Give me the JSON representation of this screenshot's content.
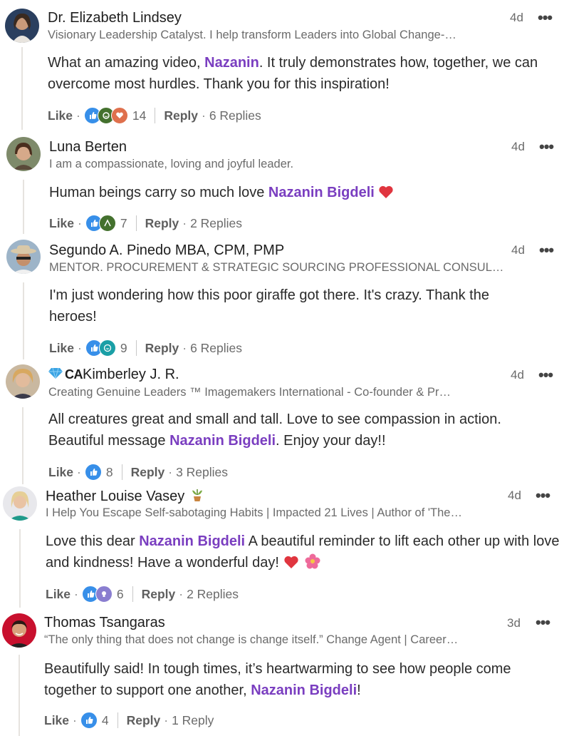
{
  "comments": [
    {
      "name": "Dr. Elizabeth Lindsey",
      "headline": "Visionary Leadership Catalyst. I help transform Leaders into Global Change-…",
      "time": "4d",
      "text_parts": [
        "What an amazing video, ",
        "Nazanin",
        ". It truly demonstrates how, together, we can overcome most hurdles. Thank you for this inspiration!"
      ],
      "like": "Like",
      "reactions": [
        "like",
        "celebrate",
        "love"
      ],
      "count": "14",
      "reply": "Reply",
      "replies": "6 Replies"
    },
    {
      "name": "Luna Berten",
      "headline": "I am a compassionate, loving and joyful leader.",
      "time": "4d",
      "text_parts": [
        "Human beings carry so much love ",
        "Nazanin Bigdeli",
        " "
      ],
      "like": "Like",
      "reactions": [
        "like",
        "support"
      ],
      "count": "7",
      "reply": "Reply",
      "replies": "2 Replies"
    },
    {
      "name": "Segundo A. Pinedo MBA, CPM, PMP",
      "headline": "MENTOR. PROCUREMENT & STRATEGIC SOURCING PROFESSIONAL CONSUL…",
      "time": "4d",
      "text_parts": [
        "I'm just wondering how this poor giraffe got there. It's crazy. Thank the heroes!"
      ],
      "like": "Like",
      "reactions": [
        "like",
        "funny"
      ],
      "count": "9",
      "reply": "Reply",
      "replies": "6 Replies"
    },
    {
      "name_prefix": "CA",
      "name": "Kimberley J. R.",
      "headline": "Creating Genuine Leaders ™ Imagemakers International - Co-founder & Pr…",
      "time": "4d",
      "text_parts": [
        "All creatures great and small and tall. Love to see compassion in action. Beautiful message ",
        "Nazanin Bigdeli",
        ". Enjoy your day!!"
      ],
      "like": "Like",
      "reactions": [
        "like"
      ],
      "count": "8",
      "reply": "Reply",
      "replies": "3 Replies"
    },
    {
      "name": "Heather Louise Vasey",
      "headline": "I Help You Escape Self-sabotaging Habits | Impacted 21 Lives | Author of 'The…",
      "time": "4d",
      "text_parts": [
        "Love this dear ",
        "Nazanin Bigdeli",
        " A beautiful reminder to lift each other up with love and kindness! Have a wonderful day! "
      ],
      "like": "Like",
      "reactions": [
        "like",
        "insightful"
      ],
      "count": "6",
      "reply": "Reply",
      "replies": "2 Replies"
    },
    {
      "name": "Thomas Tsangaras",
      "headline": "“The only thing that does not change is change itself.” Change Agent | Career…",
      "time": "3d",
      "text_parts": [
        "Beautifully said! In tough times, it’s heartwarming to see how people come together to support one another, ",
        "Nazanin Bigdeli",
        "!"
      ],
      "like": "Like",
      "reactions": [
        "like"
      ],
      "count": "4",
      "reply": "Reply",
      "replies": "1 Reply"
    }
  ],
  "more_label": "•••",
  "colors": {
    "mention": "#7a3ec0",
    "like_react": "#378fe9",
    "celebrate_react": "#44712e",
    "love_react": "#df704d",
    "thread_line": "#e6e3df"
  }
}
